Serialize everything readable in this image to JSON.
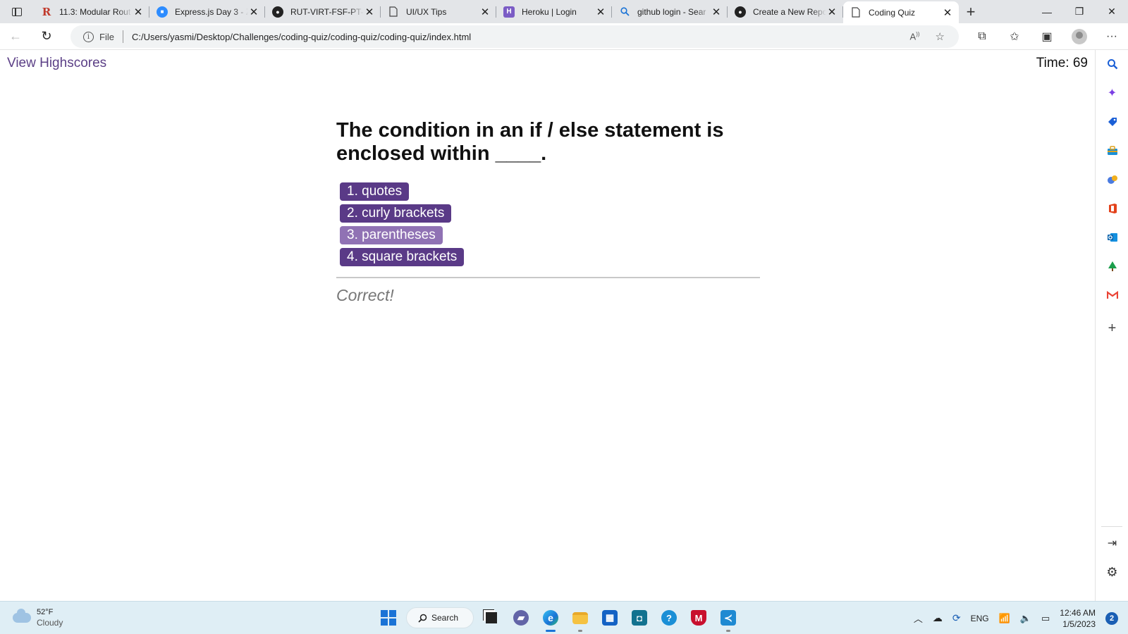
{
  "browser": {
    "tabs": [
      {
        "title": "11.3: Modular Rout",
        "icon": "r-logo-icon",
        "color": "#c0392b"
      },
      {
        "title": "Express.js Day 3 - Z",
        "icon": "zoom-icon",
        "color": "#2d8cff"
      },
      {
        "title": "RUT-VIRT-FSF-PT-1",
        "icon": "github-icon",
        "color": "#222222"
      },
      {
        "title": "UI/UX Tips",
        "icon": "document-icon",
        "color": "#555555"
      },
      {
        "title": "Heroku | Login",
        "icon": "heroku-icon",
        "color": "#7b5cc5"
      },
      {
        "title": "github login - Sear",
        "icon": "search-icon",
        "color": "#1a73d6"
      },
      {
        "title": "Create a New Repo",
        "icon": "github-icon",
        "color": "#222222"
      },
      {
        "title": "Coding Quiz",
        "icon": "document-icon",
        "color": "#555555",
        "active": true
      }
    ],
    "address": {
      "scheme_label": "File",
      "url": "C:/Users/yasmi/Desktop/Challenges/coding-quiz/coding-quiz/coding-quiz/index.html"
    }
  },
  "quiz": {
    "view_highscores": "View Highscores",
    "timer": "Time: 69",
    "question": "The condition in an if / else statement is enclosed within ____.",
    "choices": [
      "1. quotes",
      "2. curly brackets",
      "3. parentheses",
      "4. square brackets"
    ],
    "feedback": "Correct!"
  },
  "taskbar": {
    "weather": {
      "temp": "52°F",
      "condition": "Cloudy"
    },
    "search_label": "Search",
    "language": "ENG",
    "time": "12:46 AM",
    "date": "1/5/2023",
    "notification_count": "2"
  },
  "colors": {
    "accent": "#5a3a87",
    "accent_hover": "#9072b4",
    "link": "#5b3f86"
  }
}
